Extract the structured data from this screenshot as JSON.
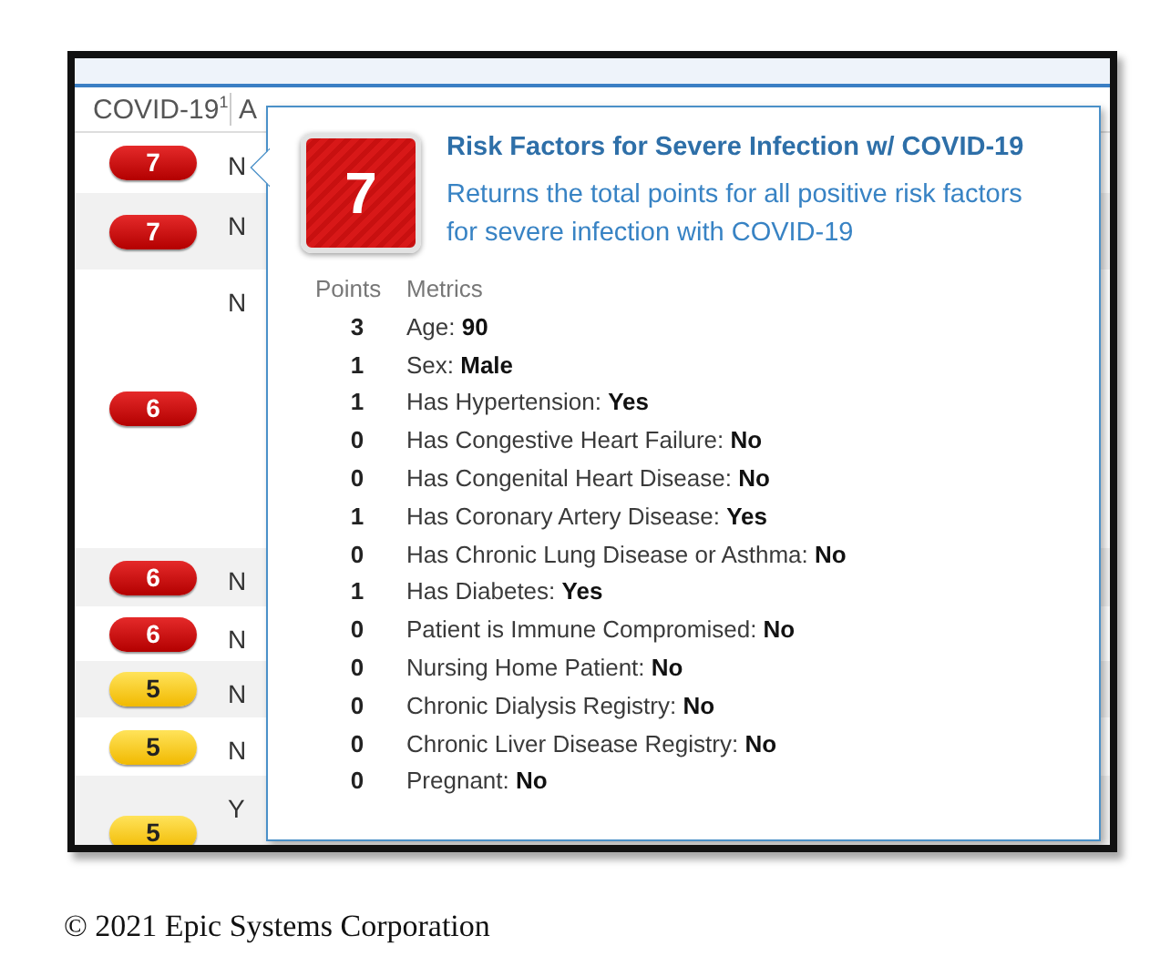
{
  "header": {
    "columns": [
      {
        "label": "COVID-19",
        "sort": "1"
      },
      {
        "label": "A"
      }
    ]
  },
  "rows": [
    {
      "score": "7",
      "kind": "high",
      "col2": "N"
    },
    {
      "score": "7",
      "kind": "high",
      "col2": "N"
    },
    {
      "score": "6",
      "kind": "high",
      "col2": "N"
    },
    {
      "score": "6",
      "kind": "high",
      "col2": "N"
    },
    {
      "score": "6",
      "kind": "high",
      "col2": "N"
    },
    {
      "score": "5",
      "kind": "medium",
      "col2": "N"
    },
    {
      "score": "5",
      "kind": "medium",
      "col2": "N"
    },
    {
      "score": "5",
      "kind": "medium",
      "col2": "Y"
    }
  ],
  "popover": {
    "score": "7",
    "title": "Risk Factors for Severe Infection w/ COVID-19",
    "description": "Returns the total points for all positive risk factors for severe infection with COVID-19",
    "columns": [
      "Points",
      "Metrics"
    ],
    "metrics": [
      {
        "points": "3",
        "text": "Age: **90**"
      },
      {
        "points": "1",
        "text": "Sex: **Male**"
      },
      {
        "points": "1",
        "text": "Has Hypertension: **Yes**"
      },
      {
        "points": "0",
        "text": "Has Congestive Heart Failure: **No**"
      },
      {
        "points": "0",
        "text": "Has Congenital Heart Disease: **No**"
      },
      {
        "points": "1",
        "text": "Has Coronary Artery Disease: **Yes**"
      },
      {
        "points": "0",
        "text": "Has Chronic Lung Disease or Asthma: **No**"
      },
      {
        "points": "1",
        "text": "Has Diabetes: **Yes**"
      },
      {
        "points": "0",
        "text": "Patient is Immune Compromised: **No**"
      },
      {
        "points": "0",
        "text": "Nursing Home Patient: **No**"
      },
      {
        "points": "0",
        "text": "Chronic Dialysis Registry: **No**"
      },
      {
        "points": "0",
        "text": "Chronic Liver Disease Registry: **No**"
      },
      {
        "points": "0",
        "text": "Pregnant: **No**"
      }
    ]
  },
  "caption": "© 2021 Epic Systems Corporation"
}
